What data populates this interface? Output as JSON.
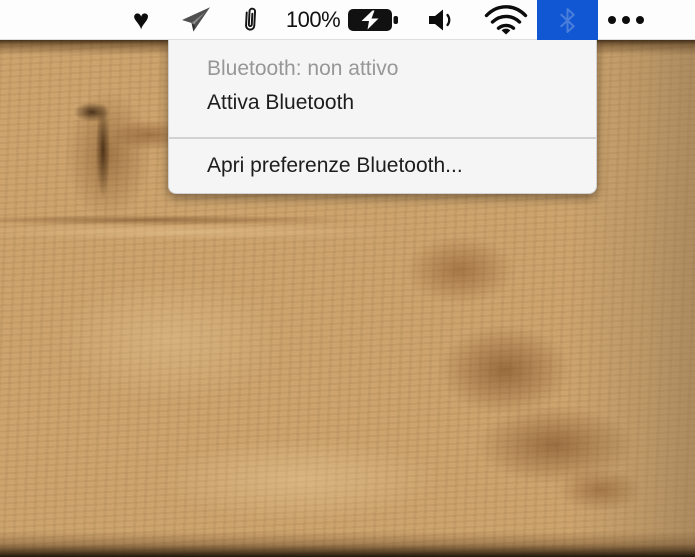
{
  "menu_bar": {
    "battery_level": "100%",
    "icons": [
      {
        "name": "heart-icon",
        "glyph": "♥"
      },
      {
        "name": "telegram-icon",
        "glyph": "paper-plane-shape"
      },
      {
        "name": "paperclip-icon",
        "glyph": "paperclip-shape"
      },
      {
        "name": "battery-charging-icon",
        "glyph": "battery-bolt-shape"
      },
      {
        "name": "volume-icon",
        "glyph": "speaker-wave-shape"
      },
      {
        "name": "wifi-icon",
        "glyph": "wifi-arcs-shape"
      },
      {
        "name": "bluetooth-icon",
        "glyph": "bluetooth-rune-shape",
        "state": "open"
      },
      {
        "name": "overflow-ellipsis-icon",
        "glyph": "•••"
      }
    ]
  },
  "bluetooth_menu": {
    "status_label": "Bluetooth: non attivo",
    "enable_label": "Attiva Bluetooth",
    "preferences_label": "Apri preferenze Bluetooth..."
  },
  "colors": {
    "bluetooth_highlight": "#1157d3",
    "bluetooth_glyph": "#4a7edb",
    "menubar_bg": "#fdfdfd",
    "menu_bg": "#f5f5f5",
    "menu_text": "#1d1d1d",
    "menu_text_secondary": "#979797",
    "separator": "#d2d2d2",
    "icon_color": "#0c0c0c"
  }
}
